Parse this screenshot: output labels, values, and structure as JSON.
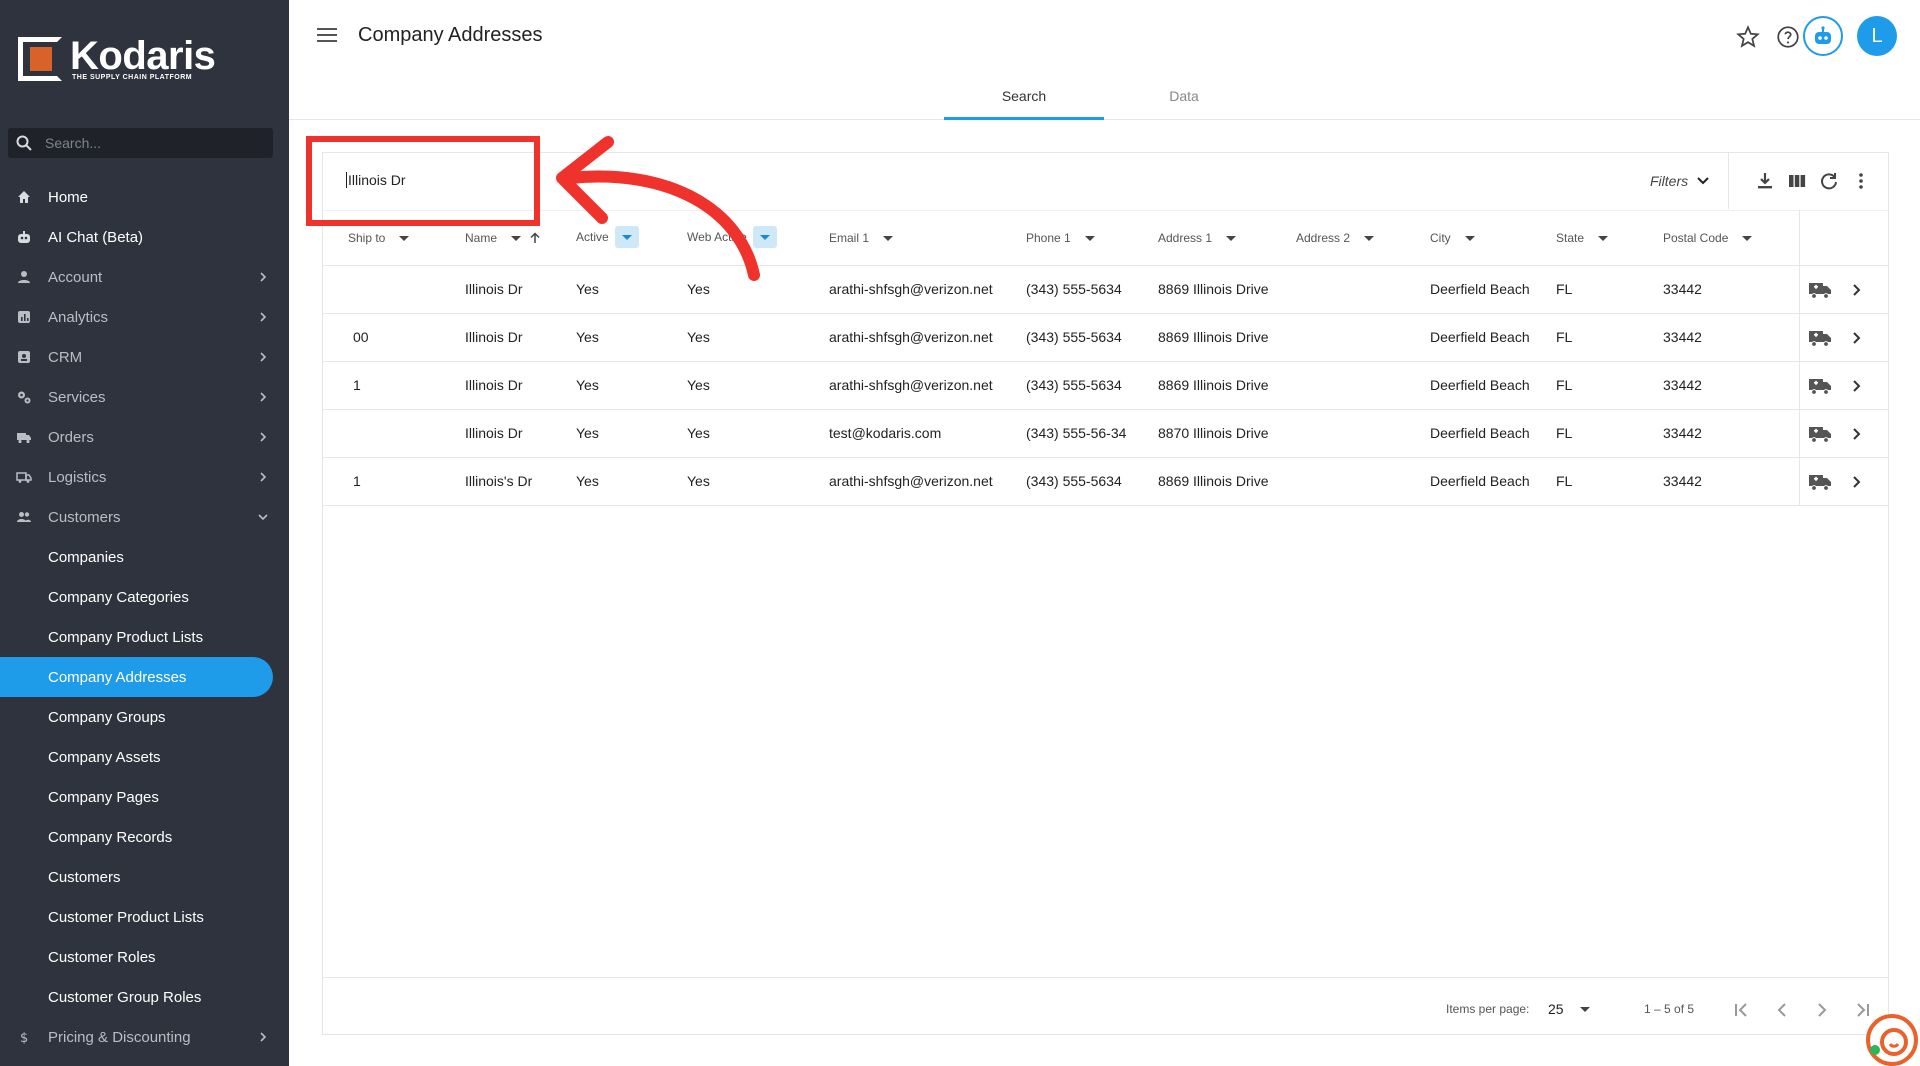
{
  "brand": {
    "name": "Kodaris",
    "tagline": "THE SUPPLY CHAIN PLATFORM"
  },
  "sidebar": {
    "search_placeholder": "Search...",
    "items": [
      {
        "label": "Home",
        "icon": "home-icon"
      },
      {
        "label": "AI Chat (Beta)",
        "icon": "robot-icon"
      },
      {
        "label": "Account",
        "icon": "person-icon"
      },
      {
        "label": "Analytics",
        "icon": "analytics-icon"
      },
      {
        "label": "CRM",
        "icon": "contact-card-icon"
      },
      {
        "label": "Services",
        "icon": "gears-icon"
      },
      {
        "label": "Orders",
        "icon": "truck-icon"
      },
      {
        "label": "Logistics",
        "icon": "shipping-icon"
      },
      {
        "label": "Customers",
        "icon": "people-icon"
      }
    ],
    "customer_subitems": [
      "Companies",
      "Company Categories",
      "Company Product Lists",
      "Company Addresses",
      "Company Groups",
      "Company Assets",
      "Company Pages",
      "Company Records",
      "Customers",
      "Customer Product Lists",
      "Customer Roles",
      "Customer Group Roles"
    ],
    "bottom_item": {
      "label": "Pricing & Discounting",
      "icon": "dollar-icon"
    }
  },
  "header": {
    "title": "Company Addresses",
    "avatar_letter": "L",
    "tabs": [
      "Search",
      "Data"
    ]
  },
  "toolbar": {
    "search_value": "Illinois Dr",
    "filters_label": "Filters"
  },
  "table": {
    "columns": [
      "Ship to",
      "Name",
      "Active",
      "Web Active",
      "Email 1",
      "Phone 1",
      "Address 1",
      "Address 2",
      "City",
      "State",
      "Postal Code"
    ],
    "rows": [
      {
        "ship_to": "",
        "name": "Illinois Dr",
        "active": "Yes",
        "web_active": "Yes",
        "email": "arathi-shfsgh@verizon.net",
        "phone": "(343) 555-5634",
        "address1": "8869 Illinois Drive",
        "address2": "",
        "city": "Deerfield Beach",
        "state": "FL",
        "postal": "33442"
      },
      {
        "ship_to": "00",
        "name": "Illinois Dr",
        "active": "Yes",
        "web_active": "Yes",
        "email": "arathi-shfsgh@verizon.net",
        "phone": "(343) 555-5634",
        "address1": "8869 Illinois Drive",
        "address2": "",
        "city": "Deerfield Beach",
        "state": "FL",
        "postal": "33442"
      },
      {
        "ship_to": "1",
        "name": "Illinois Dr",
        "active": "Yes",
        "web_active": "Yes",
        "email": "arathi-shfsgh@verizon.net",
        "phone": "(343) 555-5634",
        "address1": "8869 Illinois Drive",
        "address2": "",
        "city": "Deerfield Beach",
        "state": "FL",
        "postal": "33442"
      },
      {
        "ship_to": "",
        "name": "Illinois Dr",
        "active": "Yes",
        "web_active": "Yes",
        "email": "test@kodaris.com",
        "phone": "(343) 555-56-34",
        "address1": "8870 Illinois Drive",
        "address2": "",
        "city": "Deerfield Beach",
        "state": "FL",
        "postal": "33442"
      },
      {
        "ship_to": "1",
        "name": "Illinois's Dr",
        "active": "Yes",
        "web_active": "Yes",
        "email": "arathi-shfsgh@verizon.net",
        "phone": "(343) 555-5634",
        "address1": "8869 Illinois Drive",
        "address2": "",
        "city": "Deerfield Beach",
        "state": "FL",
        "postal": "33442"
      }
    ]
  },
  "paginator": {
    "items_per_page_label": "Items per page:",
    "items_per_page": "25",
    "range": "1 – 5 of 5"
  },
  "colors": {
    "accent": "#1e9be9",
    "sidebar_bg": "#2f333d",
    "annotation": "#f0322c",
    "brand_orange": "#d9622b"
  }
}
